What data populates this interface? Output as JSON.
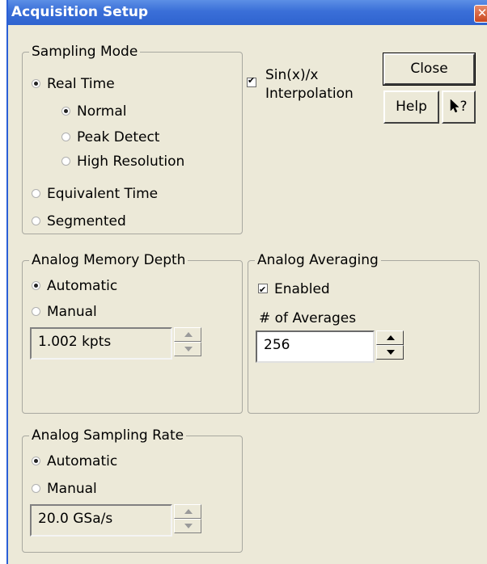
{
  "window": {
    "title": "Acquisition Setup",
    "close_glyph": "✕"
  },
  "sampling_mode": {
    "legend": "Sampling Mode",
    "real_time": "Real Time",
    "normal": "Normal",
    "peak_detect": "Peak Detect",
    "high_resolution": "High Resolution",
    "equivalent_time": "Equivalent Time",
    "segmented": "Segmented",
    "selected": "Real Time",
    "real_time_submode_selected": "Normal"
  },
  "interpolation": {
    "label_line1": "Sin(x)/x",
    "label_line2": "Interpolation",
    "checked": true
  },
  "buttons": {
    "close": "Close",
    "help": "Help",
    "whats_this": "?"
  },
  "memory_depth": {
    "legend": "Analog Memory Depth",
    "automatic": "Automatic",
    "manual": "Manual",
    "selected": "Automatic",
    "value": "1.002 kpts"
  },
  "averaging": {
    "legend": "Analog Averaging",
    "enabled_label": "Enabled",
    "enabled": true,
    "count_label": "# of Averages",
    "count_value": "256"
  },
  "sampling_rate": {
    "legend": "Analog Sampling Rate",
    "automatic": "Automatic",
    "manual": "Manual",
    "selected": "Automatic",
    "value": "20.0 GSa/s"
  },
  "colors": {
    "title_bar": "#2f63cf",
    "dialog_face": "#ece9d8",
    "close_button": "#c9471f"
  }
}
